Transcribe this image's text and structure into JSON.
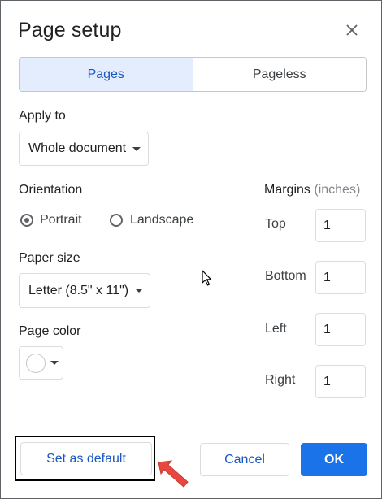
{
  "dialog": {
    "title": "Page setup",
    "close_icon": "close-icon"
  },
  "mode_tabs": [
    {
      "label": "Pages",
      "active": true
    },
    {
      "label": "Pageless",
      "active": false
    }
  ],
  "apply_to": {
    "label": "Apply to",
    "value": "Whole document"
  },
  "orientation": {
    "label": "Orientation",
    "options": [
      {
        "label": "Portrait",
        "checked": true
      },
      {
        "label": "Landscape",
        "checked": false
      }
    ]
  },
  "paper_size": {
    "label": "Paper size",
    "value": "Letter (8.5\" x 11\")"
  },
  "page_color": {
    "label": "Page color",
    "value_color": "#ffffff"
  },
  "margins": {
    "heading": "Margins",
    "unit": "(inches)",
    "fields": [
      {
        "label": "Top",
        "value": "1"
      },
      {
        "label": "Bottom",
        "value": "1"
      },
      {
        "label": "Left",
        "value": "1"
      },
      {
        "label": "Right",
        "value": "1"
      }
    ]
  },
  "buttons": {
    "set_default": "Set as default",
    "cancel": "Cancel",
    "ok": "OK"
  },
  "colors": {
    "accent": "#1a73e8",
    "active_tab_bg": "#e3edfd",
    "annotation_arrow": "#e8473f"
  }
}
